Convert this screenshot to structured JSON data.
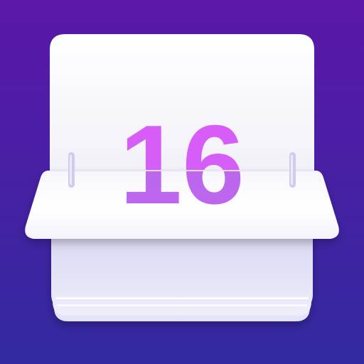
{
  "app_icon": {
    "name": "calendar-app-icon",
    "day_number": "16"
  },
  "colors": {
    "background_top": "#5b17a8",
    "background_bottom": "#322aa0",
    "page_white": "#fafafd",
    "page_shadow": "#cfd2f0",
    "stack_lavender": "#dcdcf5",
    "digit_top": "#d95cf8",
    "digit_bottom": "#c064f0",
    "ring_color": "#cfc8ee"
  }
}
